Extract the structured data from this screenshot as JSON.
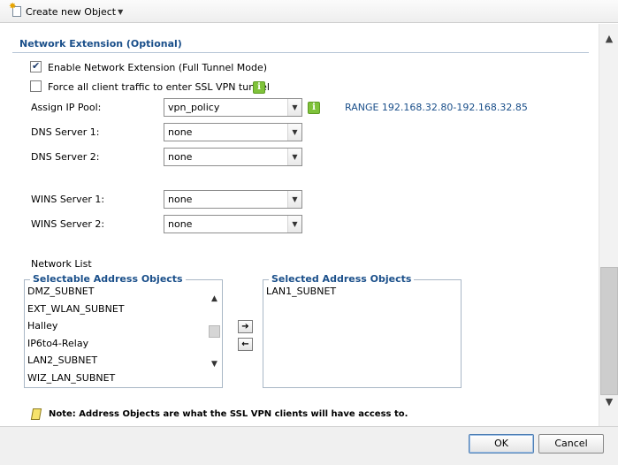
{
  "toolbar": {
    "create_label": "Create new Object"
  },
  "section": {
    "title": "Network Extension (Optional)"
  },
  "options": {
    "enable_network_extension": {
      "label": "Enable Network Extension (Full Tunnel Mode)",
      "checked": true
    },
    "force_all_traffic": {
      "label": "Force all client traffic to enter SSL VPN tunnel",
      "checked": false
    }
  },
  "fields": {
    "assign_ip_pool": {
      "label": "Assign IP Pool:",
      "value": "vpn_policy"
    },
    "range_text": "RANGE 192.168.32.80-192.168.32.85",
    "dns1": {
      "label": "DNS Server 1:",
      "value": "none"
    },
    "dns2": {
      "label": "DNS Server 2:",
      "value": "none"
    },
    "wins1": {
      "label": "WINS Server 1:",
      "value": "none"
    },
    "wins2": {
      "label": "WINS Server 2:",
      "value": "none"
    }
  },
  "network_list": {
    "label": "Network List",
    "selectable": {
      "legend": "Selectable Address Objects",
      "items": [
        "DMZ_SUBNET",
        "EXT_WLAN_SUBNET",
        "Halley",
        "IP6to4-Relay",
        "LAN2_SUBNET",
        "WIZ_LAN_SUBNET"
      ]
    },
    "selected": {
      "legend": "Selected Address Objects",
      "items": [
        "LAN1_SUBNET"
      ]
    }
  },
  "note": "Note: Address Objects are what the SSL VPN clients will have access to.",
  "buttons": {
    "ok": "OK",
    "cancel": "Cancel"
  },
  "icons": {
    "info": "i",
    "right_arrow": "➔",
    "left_arrow": "←",
    "dropdown": "▼",
    "scroll_up": "▲",
    "scroll_down": "▼"
  }
}
